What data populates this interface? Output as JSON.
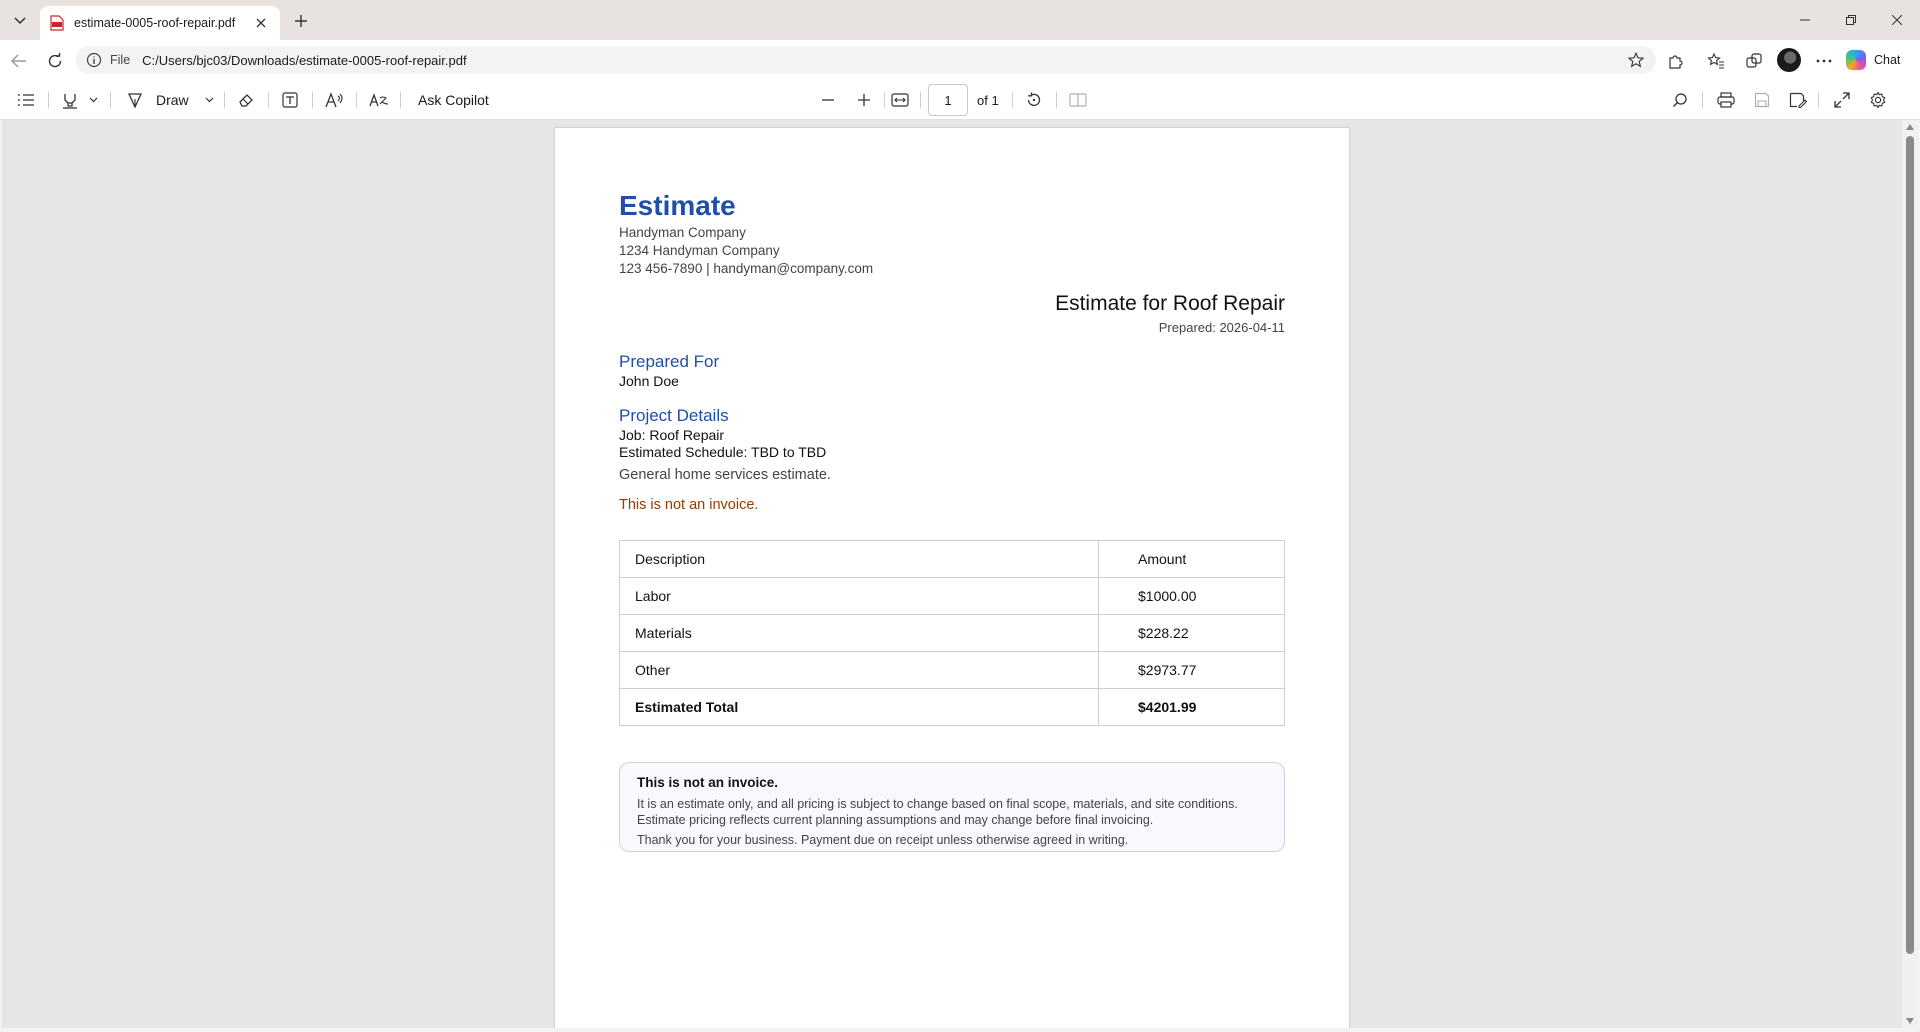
{
  "browser": {
    "tab": {
      "title": "estimate-0005-roof-repair.pdf"
    },
    "address": {
      "scheme": "File",
      "url": "C:/Users/bjc03/Downloads/estimate-0005-roof-repair.pdf"
    },
    "copilot": {
      "label": "Chat"
    }
  },
  "pdf_toolbar": {
    "draw_label": "Draw",
    "ask_copilot_label": "Ask Copilot",
    "page_current": "1",
    "page_of": "of 1"
  },
  "document": {
    "title": "Estimate",
    "company": {
      "name": "Handyman Company",
      "address": "1234 Handyman Company",
      "contact": "123 456-7890 | handyman@company.com"
    },
    "estimate_for": "Estimate for Roof Repair",
    "prepared": "Prepared: 2026-04-11",
    "prepared_for": {
      "heading": "Prepared For",
      "name": "John Doe"
    },
    "project": {
      "heading": "Project Details",
      "job": "Job: Roof Repair",
      "schedule": "Estimated Schedule: TBD to TBD"
    },
    "description": "General home services estimate.",
    "warning": "This is not an invoice.",
    "table": {
      "headers": [
        "Description",
        "Amount"
      ],
      "rows": [
        {
          "description": "Labor",
          "amount": "$1000.00"
        },
        {
          "description": "Materials",
          "amount": "$228.22"
        },
        {
          "description": "Other",
          "amount": "$2973.77"
        }
      ],
      "total": {
        "description": "Estimated Total",
        "amount": "$4201.99"
      }
    },
    "notice": {
      "title": "This is not an invoice.",
      "text": "It is an estimate only, and all pricing is subject to change based on final scope, materials, and site conditions. Estimate pricing reflects current planning assumptions and may change before final invoicing.",
      "thanks": "Thank you for your business. Payment due on receipt unless otherwise agreed in writing."
    }
  }
}
